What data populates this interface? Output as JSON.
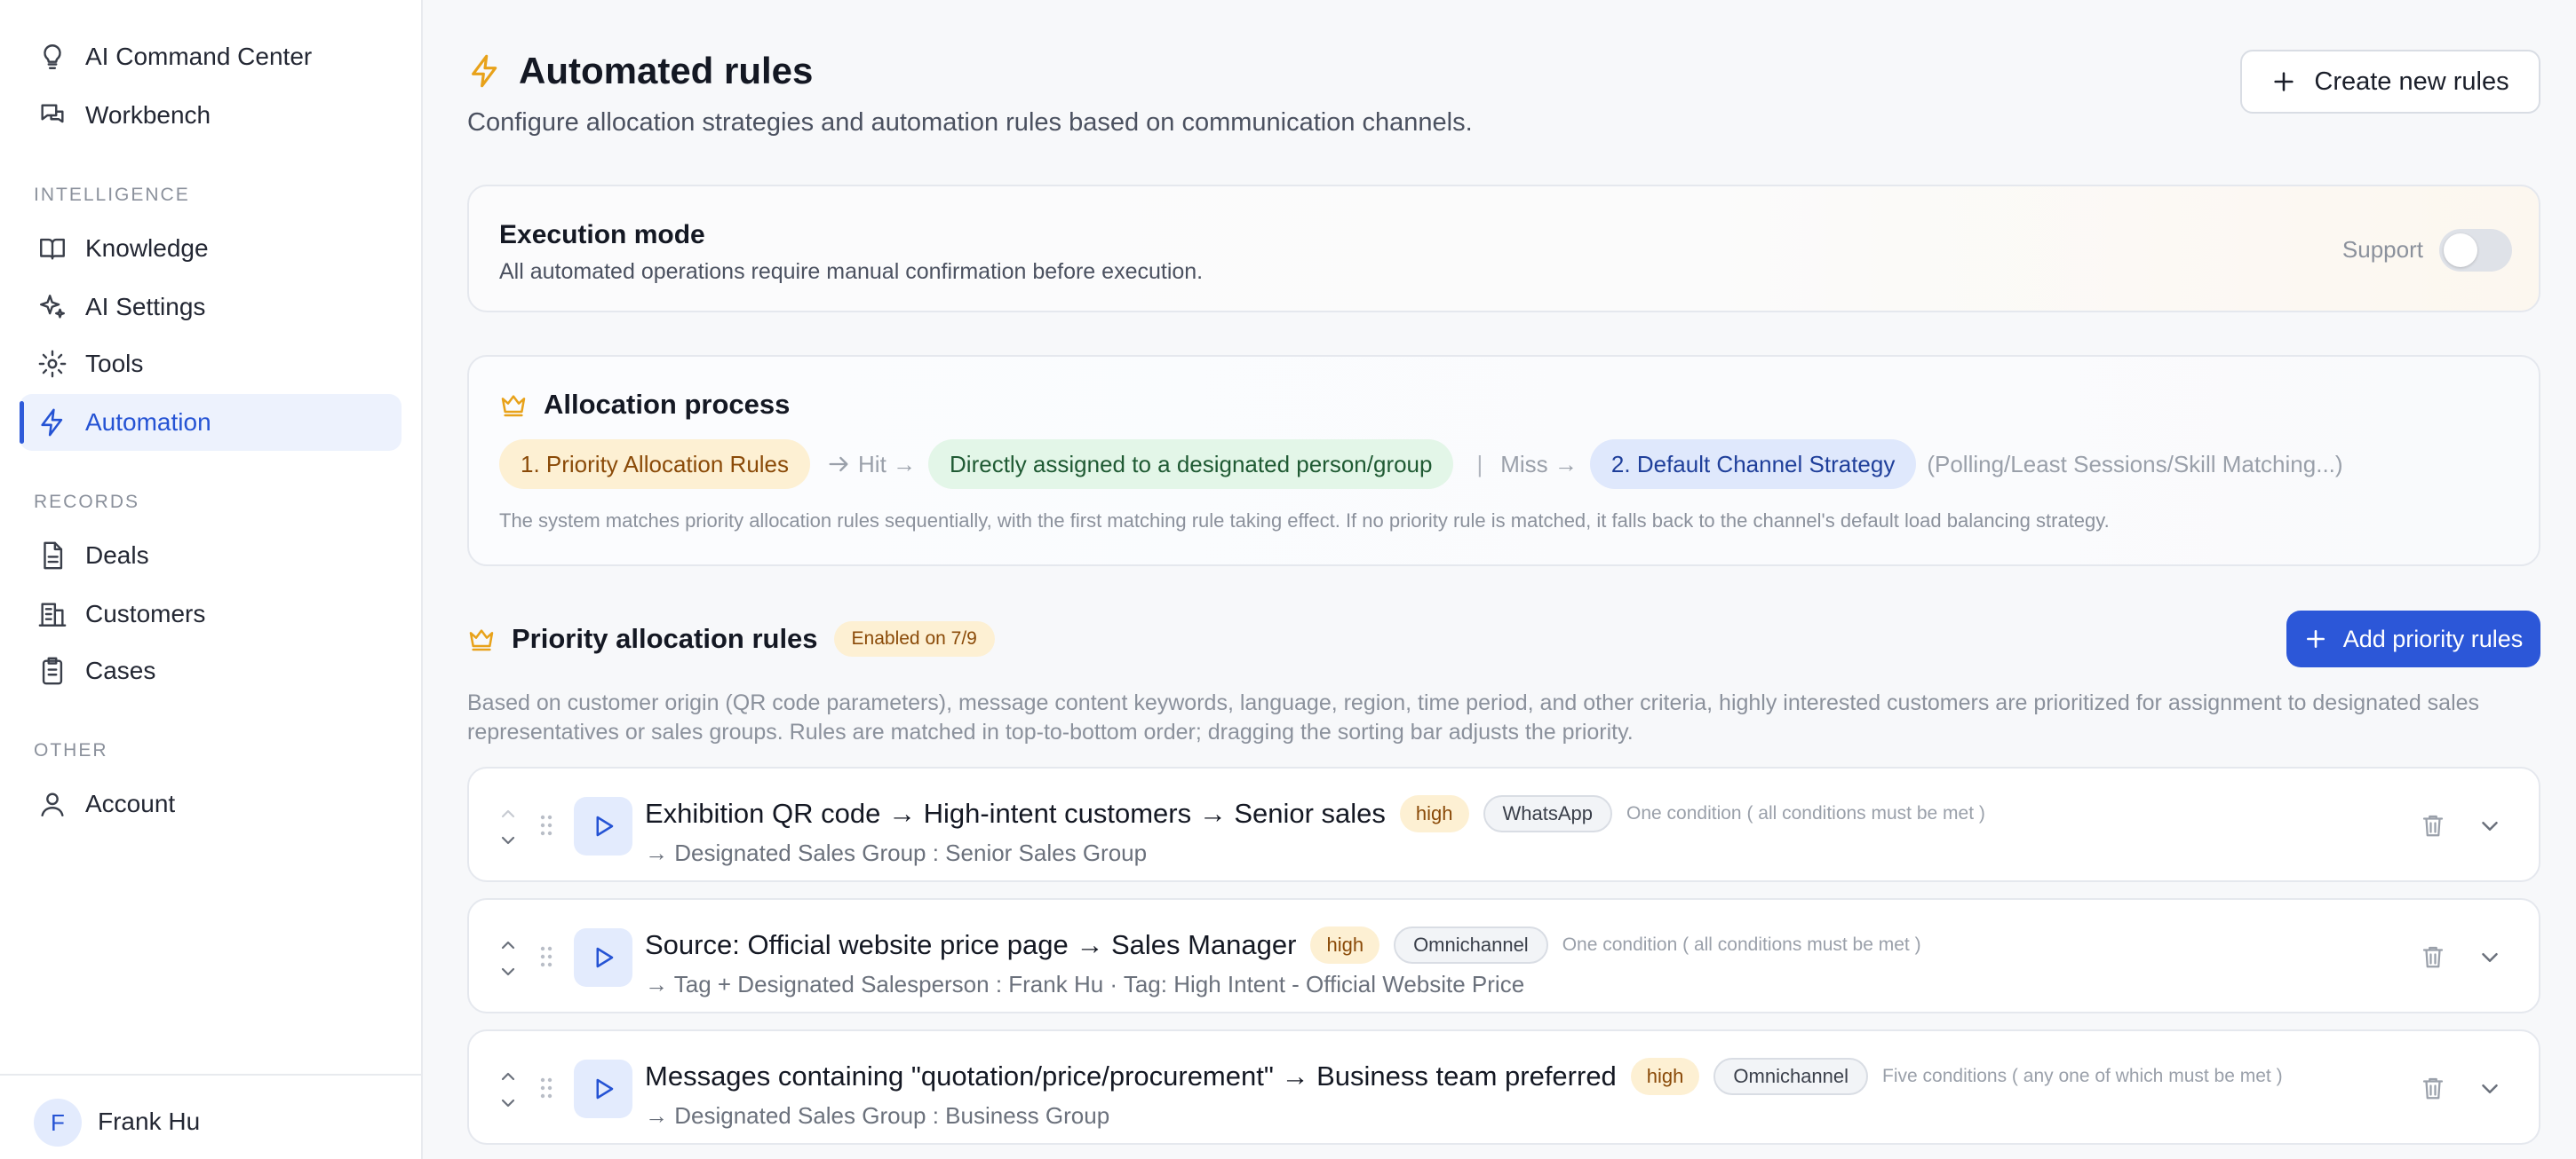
{
  "sidebar": {
    "top_items": [
      {
        "label": "AI Command Center",
        "icon": "lightbulb-icon"
      },
      {
        "label": "Workbench",
        "icon": "chat-bubbles-icon"
      }
    ],
    "sections": [
      {
        "label": "INTELLIGENCE",
        "items": [
          {
            "label": "Knowledge",
            "icon": "book-icon"
          },
          {
            "label": "AI Settings",
            "icon": "sparkles-icon"
          },
          {
            "label": "Tools",
            "icon": "gear-icon"
          },
          {
            "label": "Automation",
            "icon": "lightning-icon",
            "active": true
          }
        ]
      },
      {
        "label": "RECORDS",
        "items": [
          {
            "label": "Deals",
            "icon": "document-icon"
          },
          {
            "label": "Customers",
            "icon": "building-icon"
          },
          {
            "label": "Cases",
            "icon": "clipboard-icon"
          }
        ]
      },
      {
        "label": "OTHER",
        "items": [
          {
            "label": "Account",
            "icon": "user-icon"
          }
        ]
      }
    ],
    "user": {
      "initial": "F",
      "name": "Frank Hu"
    }
  },
  "header": {
    "title": "Automated rules",
    "subtitle": "Configure allocation strategies and automation rules based on communication channels.",
    "create_button": "Create new rules"
  },
  "execution_mode": {
    "title": "Execution mode",
    "description": "All automated operations require manual confirmation before execution.",
    "toggle_label": "Support",
    "toggle_on": false
  },
  "allocation_process": {
    "title": "Allocation process",
    "step1": "1. Priority Allocation Rules",
    "hit_label": "Hit →",
    "hit_result": "Directly assigned to a designated person/group",
    "separator": "|",
    "miss_label": "Miss →",
    "step2": "2. Default Channel Strategy",
    "step2_detail": "(Polling/Least Sessions/Skill Matching...)",
    "note": "The system matches priority allocation rules sequentially, with the first matching rule taking effect. If no priority rule is matched, it falls back to the channel's default load balancing strategy."
  },
  "priority_rules": {
    "title": "Priority allocation rules",
    "enabled_badge": "Enabled on 7/9",
    "add_button": "Add priority rules",
    "description": "Based on customer origin (QR code parameters), message content keywords, language, region, time period, and other criteria, highly interested customers are prioritized for assignment to designated sales representatives or sales groups. Rules are matched in top-to-bottom order; dragging the sorting bar adjusts the priority.",
    "rules": [
      {
        "title": "Exhibition QR code → High-intent customers → Senior sales",
        "priority": "high",
        "channel": "WhatsApp",
        "condition": "One condition ( all conditions must be met )",
        "action": "→ Designated Sales Group : Senior Sales Group"
      },
      {
        "title": "Source: Official website price page → Sales Manager",
        "priority": "high",
        "channel": "Omnichannel",
        "condition": "One condition ( all conditions must be met )",
        "action": "→ Tag + Designated Salesperson : Frank Hu · Tag: High Intent - Official Website Price"
      },
      {
        "title": "Messages containing \"quotation/price/procurement\" → Business team preferred",
        "priority": "high",
        "channel": "Omnichannel",
        "condition": "Five conditions ( any one of which must be met )",
        "action": "→ Designated Sales Group : Business Group"
      }
    ]
  },
  "colors": {
    "accent": "#2c57d8",
    "active_nav_bg": "#edf2fd",
    "high_badge_bg": "#fdf0d3",
    "hit_pill_bg": "#e3f6e8",
    "default_pill_bg": "#dfe8fc",
    "crown_icon": "#e8a21a"
  }
}
